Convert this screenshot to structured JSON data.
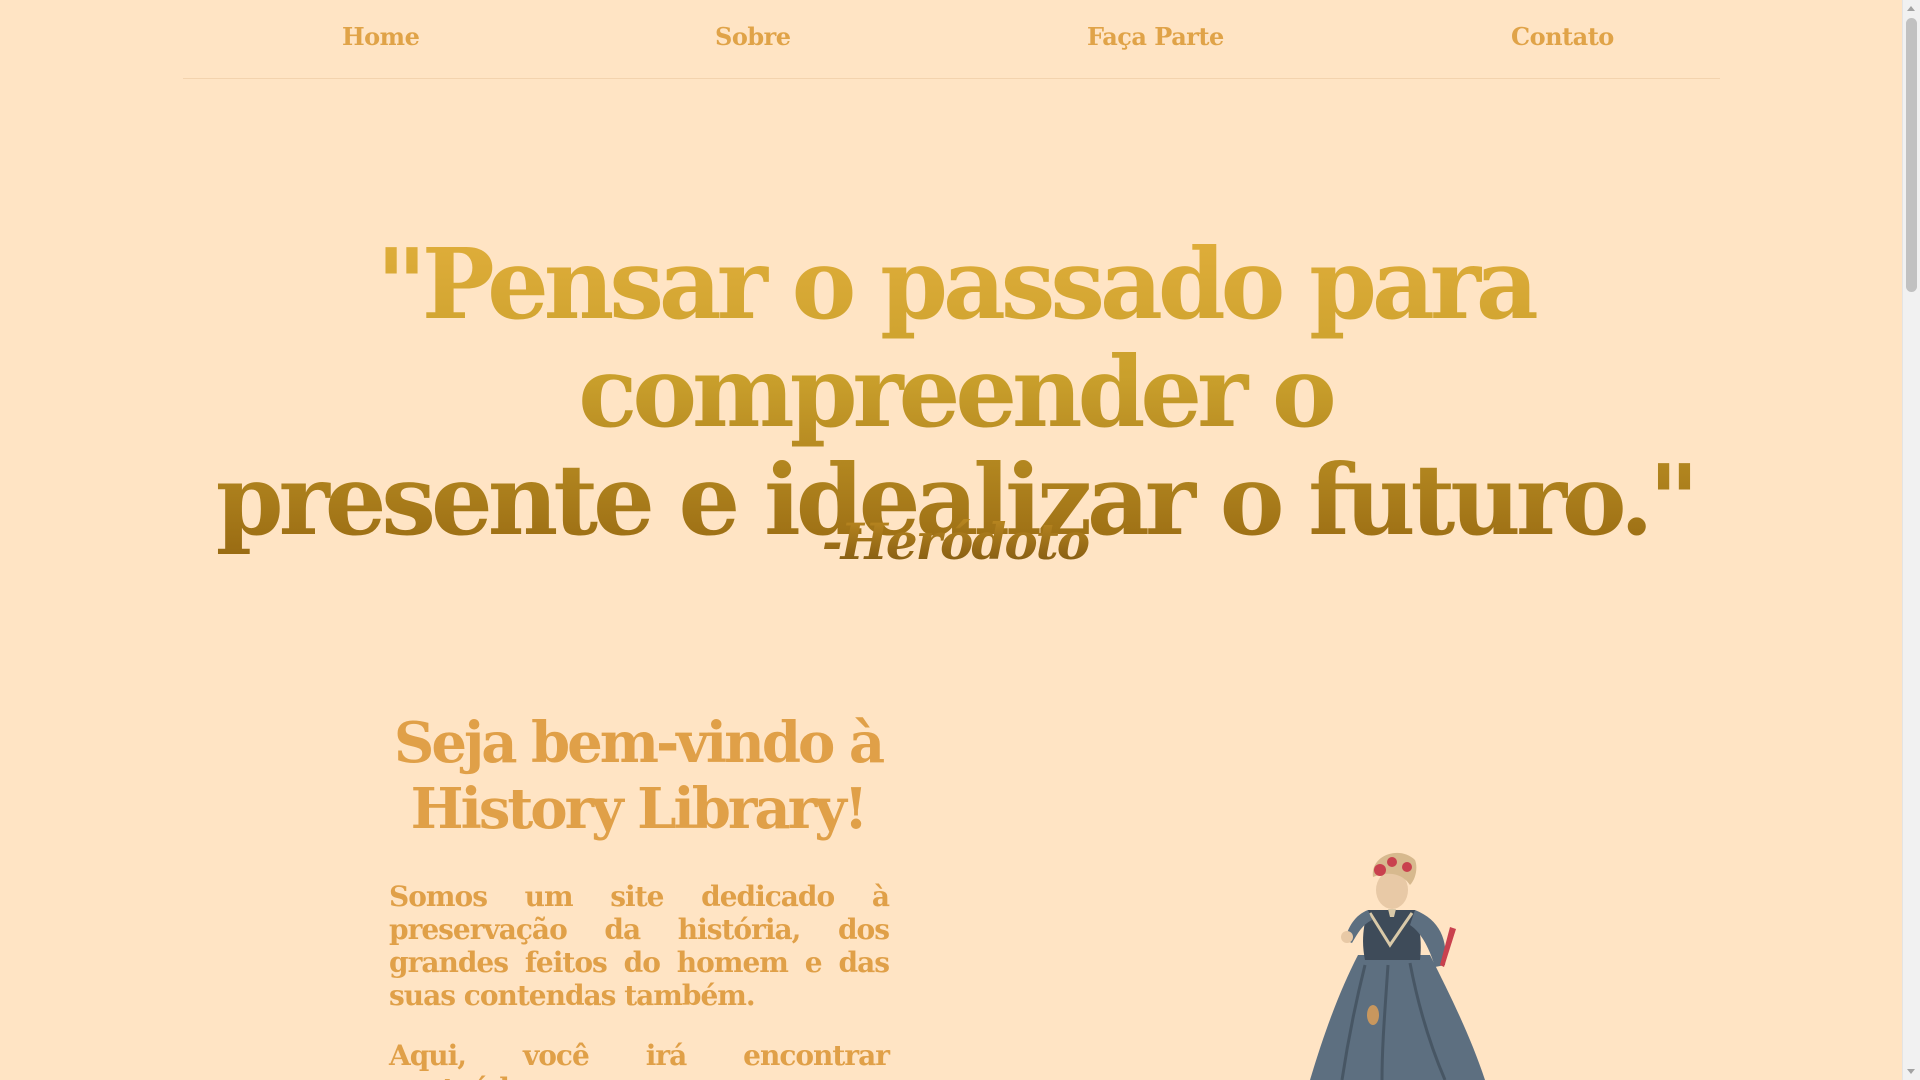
{
  "nav": {
    "items": [
      {
        "label": "Home"
      },
      {
        "label": "Sobre"
      },
      {
        "label": "Faça Parte"
      },
      {
        "label": "Contato"
      }
    ]
  },
  "hero": {
    "quote_line1": "\"Pensar o passado para compreender o",
    "quote_line2": "presente e idealizar o futuro.\"",
    "author": "-Heródoto"
  },
  "welcome": {
    "title_line1": "Seja bem-vindo à",
    "title_line2": "History Library!",
    "paragraph1": "Somos um site dedicado à preservação da história, dos grandes feitos do homem e das suas contendas também.",
    "paragraph2": "Aqui, você irá encontrar conteúdo"
  },
  "illustration": {
    "icon": "victorian-lady-illustration"
  },
  "colors": {
    "background": "#ffe4c4",
    "nav_text": "#e0a348",
    "quote_gold": "#caa02c",
    "author_brown": "#7d5510",
    "welcome_text": "#e0a048"
  }
}
